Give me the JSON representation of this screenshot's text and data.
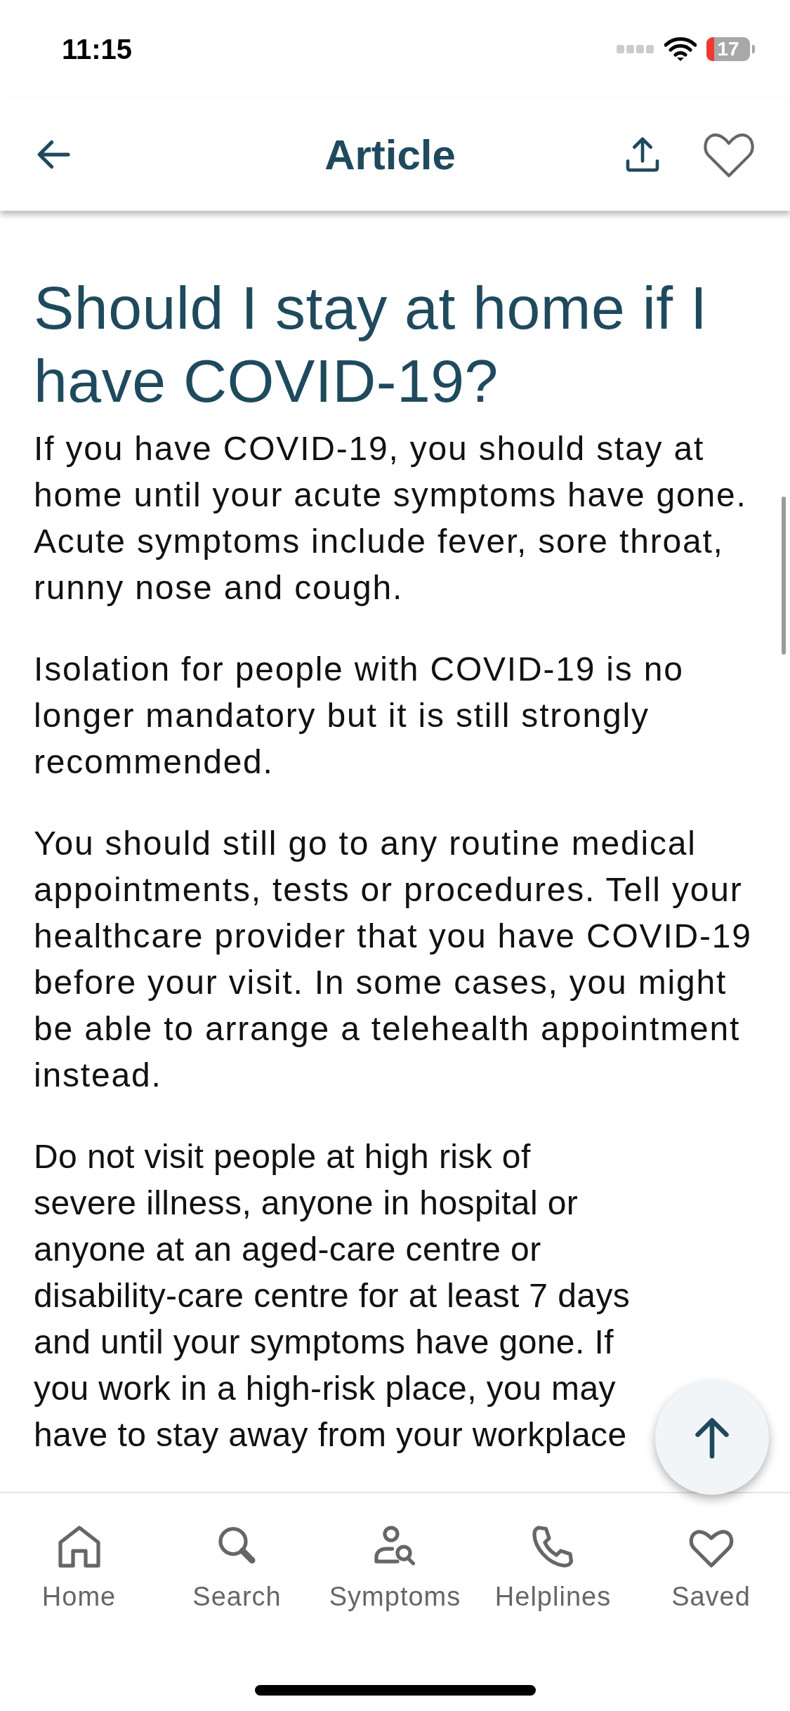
{
  "status_bar": {
    "time": "11:15",
    "battery": "17"
  },
  "header": {
    "title": "Article",
    "saved": false
  },
  "article": {
    "title": "Should I stay at home if I have COVID-19?",
    "paragraphs": [
      "If you have COVID-19, you should stay at home until your acute symptoms have gone. Acute symptoms include fever, sore throat, runny nose and cough.",
      "Isolation for people with COVID-19 is no longer mandatory but it is still strongly recommended.",
      "You should still go to any routine medical appointments, tests or procedures. Tell your healthcare provider that you have COVID-19 before your visit. In some cases, you might be able to arrange a telehealth appointment instead.",
      "Do not visit people at high risk of severe illness, anyone in hospital or anyone at an aged-care centre or disability-care centre for at least 7 days and until your symptoms have gone. If you work in a high-risk place, you may have to stay away from your workplace"
    ]
  },
  "tab_bar": [
    {
      "kind": "home",
      "label": "Home",
      "selected": false
    },
    {
      "kind": "search",
      "label": "Search",
      "selected": false
    },
    {
      "kind": "symptoms",
      "label": "Symptoms",
      "selected": false
    },
    {
      "kind": "helplines",
      "label": "Helplines",
      "selected": false
    },
    {
      "kind": "saved",
      "label": "Saved",
      "selected": false
    }
  ]
}
